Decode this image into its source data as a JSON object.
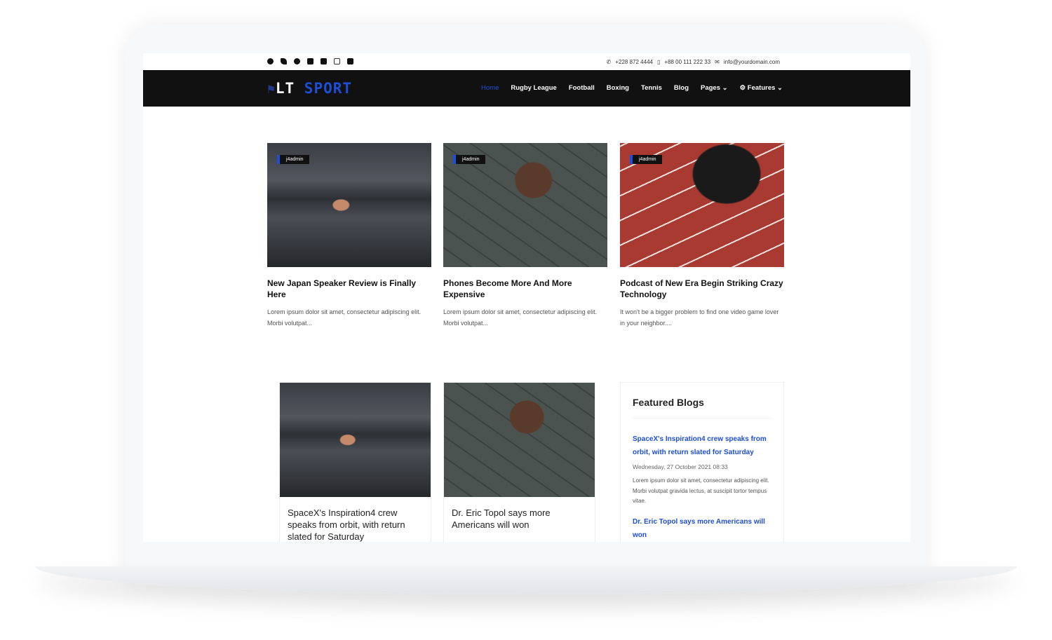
{
  "topbar": {
    "social_icons": [
      "facebook-icon",
      "twitter-icon",
      "pinterest-icon",
      "youtube-icon",
      "linkedin-icon",
      "instagram-icon",
      "flickr-icon"
    ],
    "phone": "+228 872 4444",
    "mobile": "+88 00 111 222 33",
    "email": "info@yourdomain.com"
  },
  "nav": {
    "logo_a": "LT",
    "logo_b": "SPORT",
    "items": [
      "Home",
      "Rugby League",
      "Football",
      "Boxing",
      "Tennis",
      "Blog",
      "Pages",
      "Features"
    ]
  },
  "posts": [
    {
      "badge": "j4admin",
      "title": "New Japan Speaker Review is Finally Here",
      "desc": "Lorem ipsum dolor sit amet, consectetur adipiscing elit. Morbi volutpat..."
    },
    {
      "badge": "j4admin",
      "title": "Phones Become More And More Expensive",
      "desc": "Lorem ipsum dolor sit amet, consectetur adipiscing elit. Morbi volutpat..."
    },
    {
      "badge": "j4admin",
      "title": "Podcast of New Era Begin Striking Crazy Technology",
      "desc": "It won't be a bigger problem to find one video game lover in your neighbor...."
    }
  ],
  "posts2": [
    {
      "title": "SpaceX's Inspiration4 crew speaks from orbit, with return slated for Saturday"
    },
    {
      "title": "Dr. Eric Topol says more Americans will won"
    }
  ],
  "featured": {
    "heading": "Featured Blogs",
    "items": [
      {
        "title": "SpaceX's Inspiration4 crew speaks from orbit, with return slated for Saturday",
        "date": "Wednesday, 27 October 2021 08:33",
        "text": "Lorem ipsum dolor sit amet, consectetur adipiscing elit. Morbi volutpat gravida lectus, at suscipit tortor tempus vitae."
      },
      {
        "title": "Dr. Eric Topol says more Americans will won"
      }
    ]
  }
}
